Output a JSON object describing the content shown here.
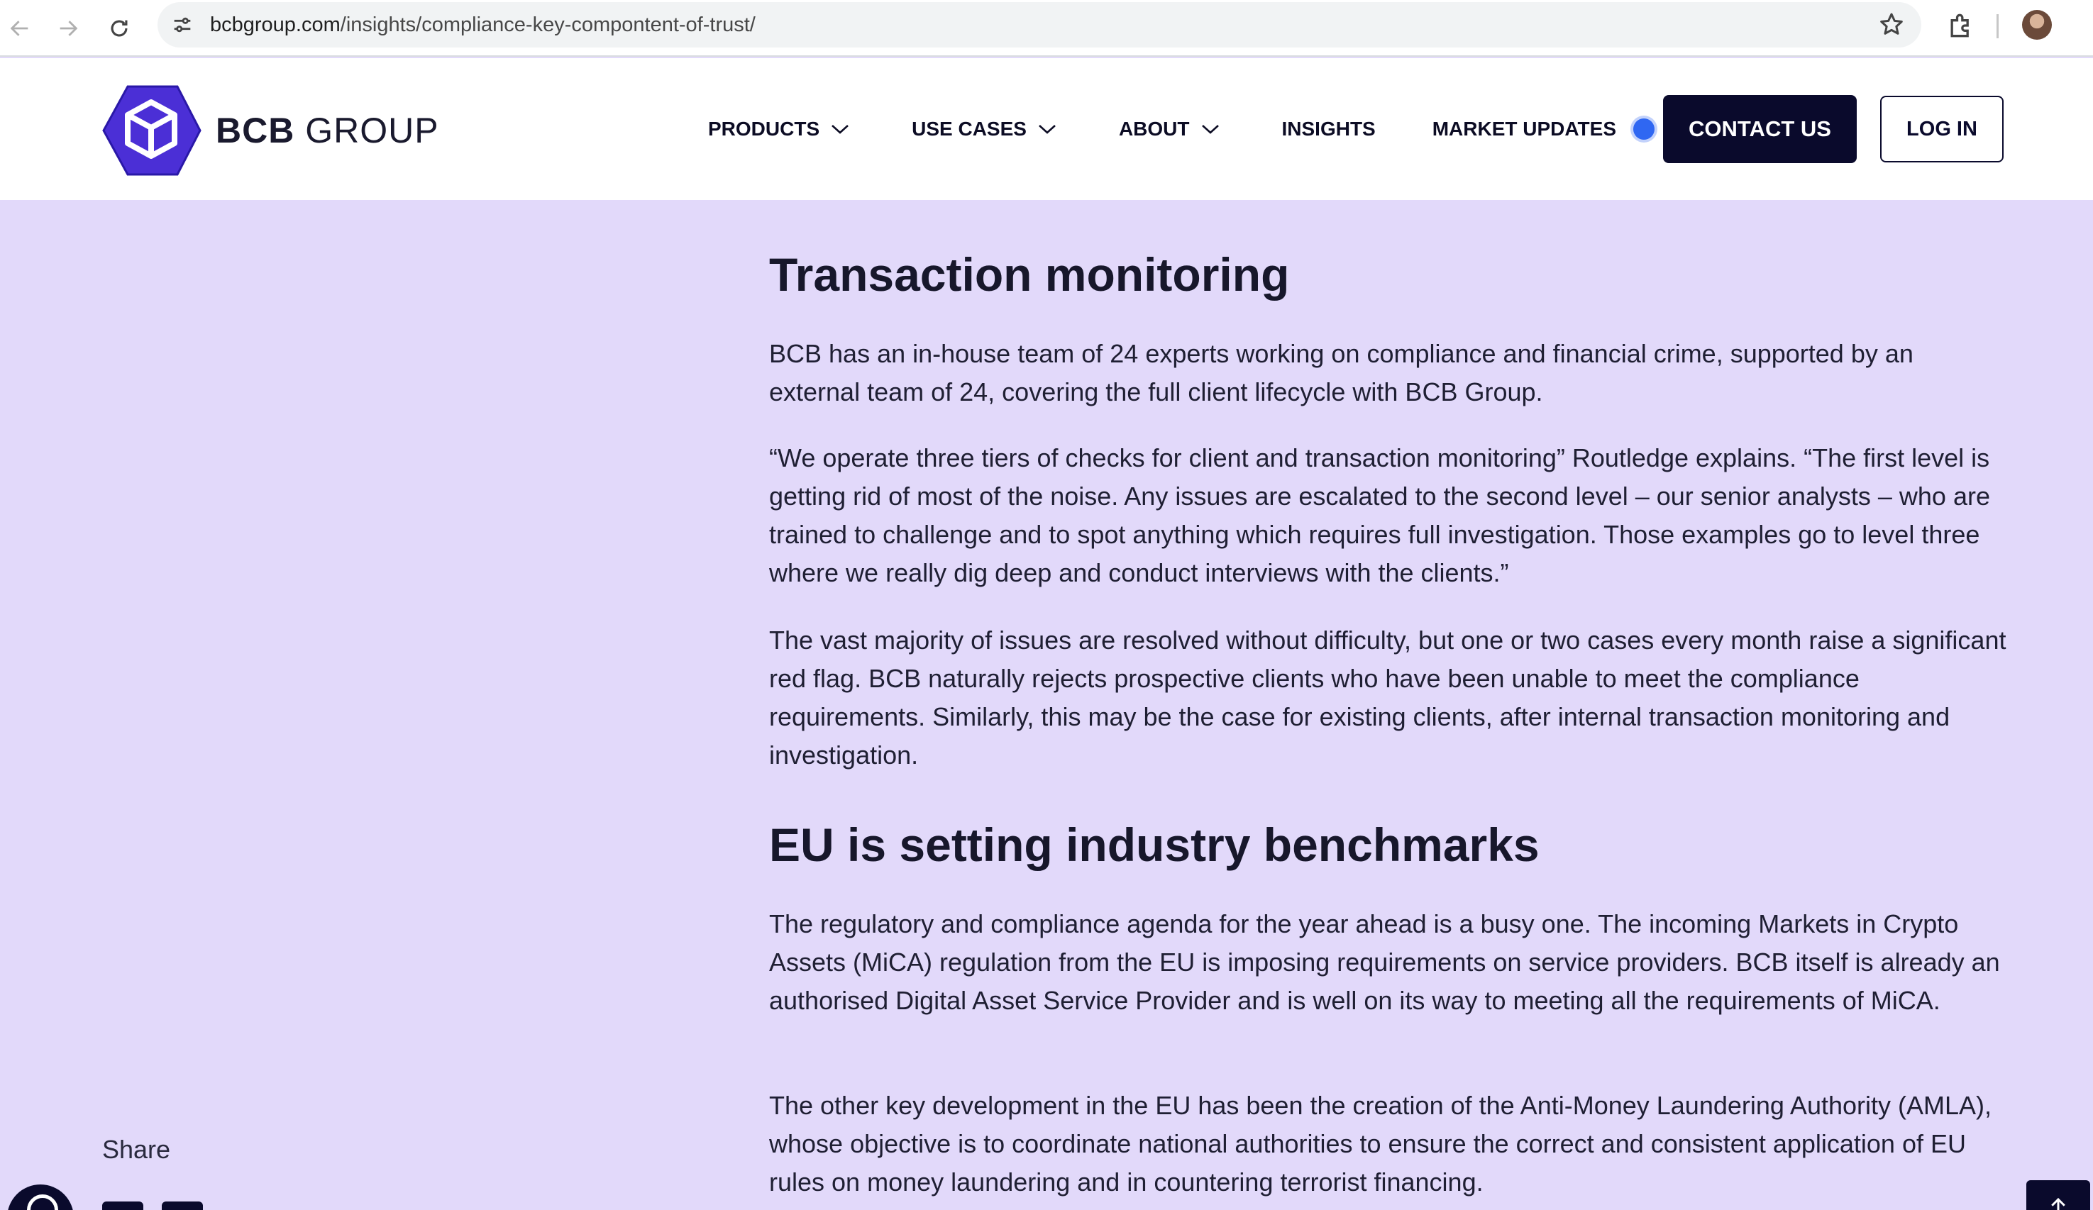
{
  "browser": {
    "url_domain": "bcbgroup.com",
    "url_path": "/insights/compliance-key-compontent-of-trust/"
  },
  "header": {
    "logo": {
      "bold": "BCB",
      "light": " GROUP"
    },
    "nav": [
      {
        "label": "PRODUCTS",
        "has_dropdown": true
      },
      {
        "label": "USE CASES",
        "has_dropdown": true
      },
      {
        "label": "ABOUT",
        "has_dropdown": true
      },
      {
        "label": "INSIGHTS",
        "has_dropdown": false
      },
      {
        "label": "MARKET UPDATES",
        "has_dropdown": false,
        "live_dot": true
      }
    ],
    "contact_label": "CONTACT US",
    "login_label": "LOG IN"
  },
  "article": {
    "heading_1": "Transaction monitoring",
    "para_1": "BCB has an in-house team of 24 experts working on compliance and financial crime, supported by an external team of 24, covering the full client lifecycle with BCB Group.",
    "para_2": "“We operate three tiers of checks for client and transaction monitoring” Routledge explains. “The first level is getting rid of most of the noise. Any issues are escalated  to the second level – our senior analysts – who are trained to challenge and to spot anything which requires full investigation. Those examples go to level three where we really dig deep and conduct interviews with the clients.”",
    "para_3": "The vast majority of issues are resolved without difficulty, but one or two cases every month raise a significant red flag. BCB naturally rejects prospective clients who have been unable to meet the compliance requirements. Similarly, this may be the case for existing clients, after internal transaction monitoring and investigation.",
    "heading_2": "EU is setting industry benchmarks",
    "para_4": "The regulatory and compliance agenda for the year ahead is a busy one. The incoming Markets in Crypto Assets (MiCA) regulation from the EU is imposing requirements on service providers. BCB itself is already an authorised Digital Asset Service Provider and is well on its way to meeting all the requirements of MiCA.",
    "para_5": "The other key development in the EU has been the creation of the Anti-Money Laundering Authority (AMLA), whose objective is to coordinate national authorities to ensure the correct and consistent application of EU rules on money laundering and in countering terrorist financing."
  },
  "sidebar": {
    "share_label": "Share"
  },
  "colors": {
    "page_background": "#e2d9fa",
    "brand_navy": "#0a0a2c",
    "logo_purple": "#4b2fd6",
    "live_dot": "#2f67f2"
  }
}
